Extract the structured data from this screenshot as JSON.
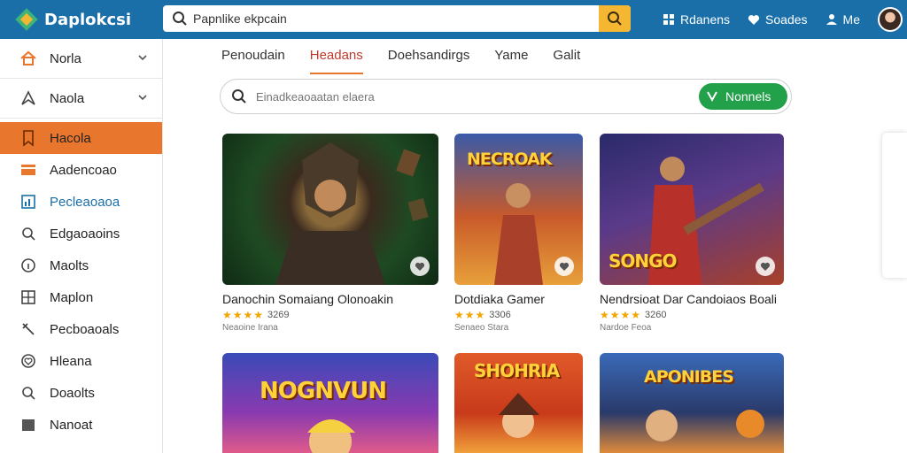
{
  "app": {
    "brand": "Daplokcsi"
  },
  "top_search": {
    "value": "Papnlike ekpcain"
  },
  "top_links": [
    {
      "icon": "grid-icon",
      "label": "Rdanens"
    },
    {
      "icon": "heart-icon",
      "label": "Soades"
    },
    {
      "icon": "person-icon",
      "label": "Me"
    }
  ],
  "sidebar": {
    "items": [
      {
        "icon": "home-icon",
        "label": "Norla",
        "chevron": true
      },
      {
        "icon": "compass-icon",
        "label": "Naola",
        "chevron": true
      },
      {
        "icon": "bookmark-icon",
        "label": "Hacola",
        "active": true
      },
      {
        "icon": "card-icon",
        "label": "Aadencoao"
      },
      {
        "icon": "chart-icon",
        "label": "Pecleaoaoa",
        "highlight": true
      },
      {
        "icon": "search-icon",
        "label": "Edgaoaoins"
      },
      {
        "icon": "info-icon",
        "label": "Maolts"
      },
      {
        "icon": "map-icon",
        "label": "Maplon"
      },
      {
        "icon": "tool-icon",
        "label": "Pecboaoals"
      },
      {
        "icon": "heart-icon",
        "label": "Hleana"
      },
      {
        "icon": "search-icon",
        "label": "Doaolts"
      },
      {
        "icon": "folder-icon",
        "label": "Nanoat"
      }
    ]
  },
  "tabs": [
    "Penoudain",
    "Headans",
    "Doehsandirgs",
    "Yame",
    "Galit"
  ],
  "inner_search": {
    "placeholder": "Einadkeaoaatan elaera",
    "button_label": "Nonnels"
  },
  "cards": [
    {
      "thumb_title": "",
      "title": "Danochin Somaiang Olonoakin",
      "rating": "3269",
      "stars": "★★★★",
      "meta": "Neaoine Irana"
    },
    {
      "thumb_title": "NECROAK",
      "title": "Dotdiaka Gamer",
      "rating": "3306",
      "stars": "★★★",
      "meta": "Senaeo Stara"
    },
    {
      "thumb_title": "SONGO",
      "title": "Nendrsioat Dar Candoiaos Boali",
      "rating": "3260",
      "stars": "★★★★",
      "meta": "Nardoe Feoa"
    },
    {
      "thumb_title": "NOGNVUN",
      "title": "",
      "rating": "",
      "stars": "",
      "meta": ""
    },
    {
      "thumb_title": "SHOHRIA",
      "title": "",
      "rating": "",
      "stars": "",
      "meta": ""
    },
    {
      "thumb_title": "APONIBES",
      "title": "",
      "rating": "",
      "stars": "",
      "meta": ""
    }
  ],
  "colors": {
    "topbar": "#1a6fa8",
    "active": "#e8762c",
    "accent_green": "#22a04a",
    "search_btn": "#f5b731"
  }
}
